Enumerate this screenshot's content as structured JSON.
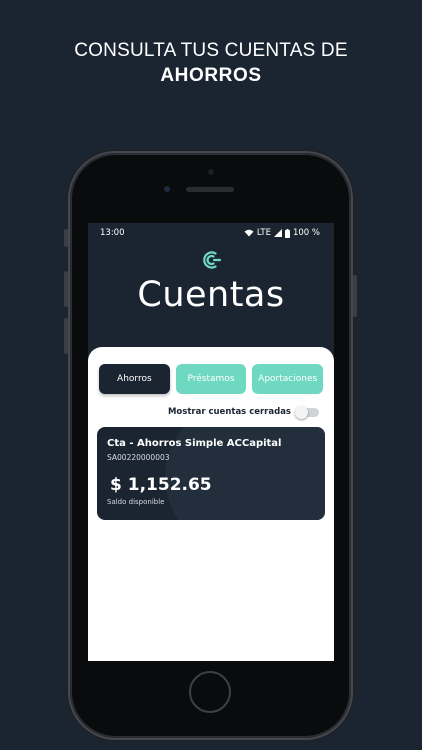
{
  "headline": {
    "line1": "CONSULTA TUS CUENTAS DE",
    "line2": "AHORROS"
  },
  "status_bar": {
    "time": "13:00",
    "network": "LTE",
    "battery": "100 %"
  },
  "app": {
    "logo_icon": "accapital-logo-icon",
    "title": "Cuentas",
    "tabs": [
      {
        "label": "Ahorros",
        "active": true
      },
      {
        "label": "Préstamos",
        "active": false
      },
      {
        "label": "Aportaciones",
        "active": false
      }
    ],
    "toggle_label": "Mostrar cuentas cerradas",
    "toggle_on": false,
    "account": {
      "name": "Cta - Ahorros Simple ACCapital",
      "number": "SA00220000003",
      "balance": "$ 1,152.65",
      "balance_label": "Saldo disponible"
    }
  },
  "colors": {
    "background": "#1b2532",
    "accent": "#6fd8c0",
    "card": "#1b2532"
  }
}
